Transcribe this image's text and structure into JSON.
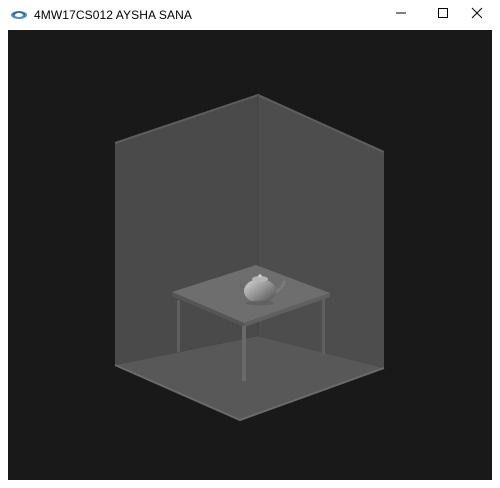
{
  "window": {
    "title": "4MW17CS012 AYSHA SANA",
    "app_icon": "opengl-app-icon",
    "controls": [
      "minimize-icon",
      "maximize-icon",
      "close-icon"
    ]
  },
  "scene": {
    "description_objects": [
      "room-left-wall",
      "room-right-wall",
      "room-floor",
      "table",
      "teapot"
    ],
    "background_color": "#191919",
    "wall_color": "#4b4b4b",
    "floor_color": "#5a5a5a",
    "table_color": "#6c6c6c"
  }
}
